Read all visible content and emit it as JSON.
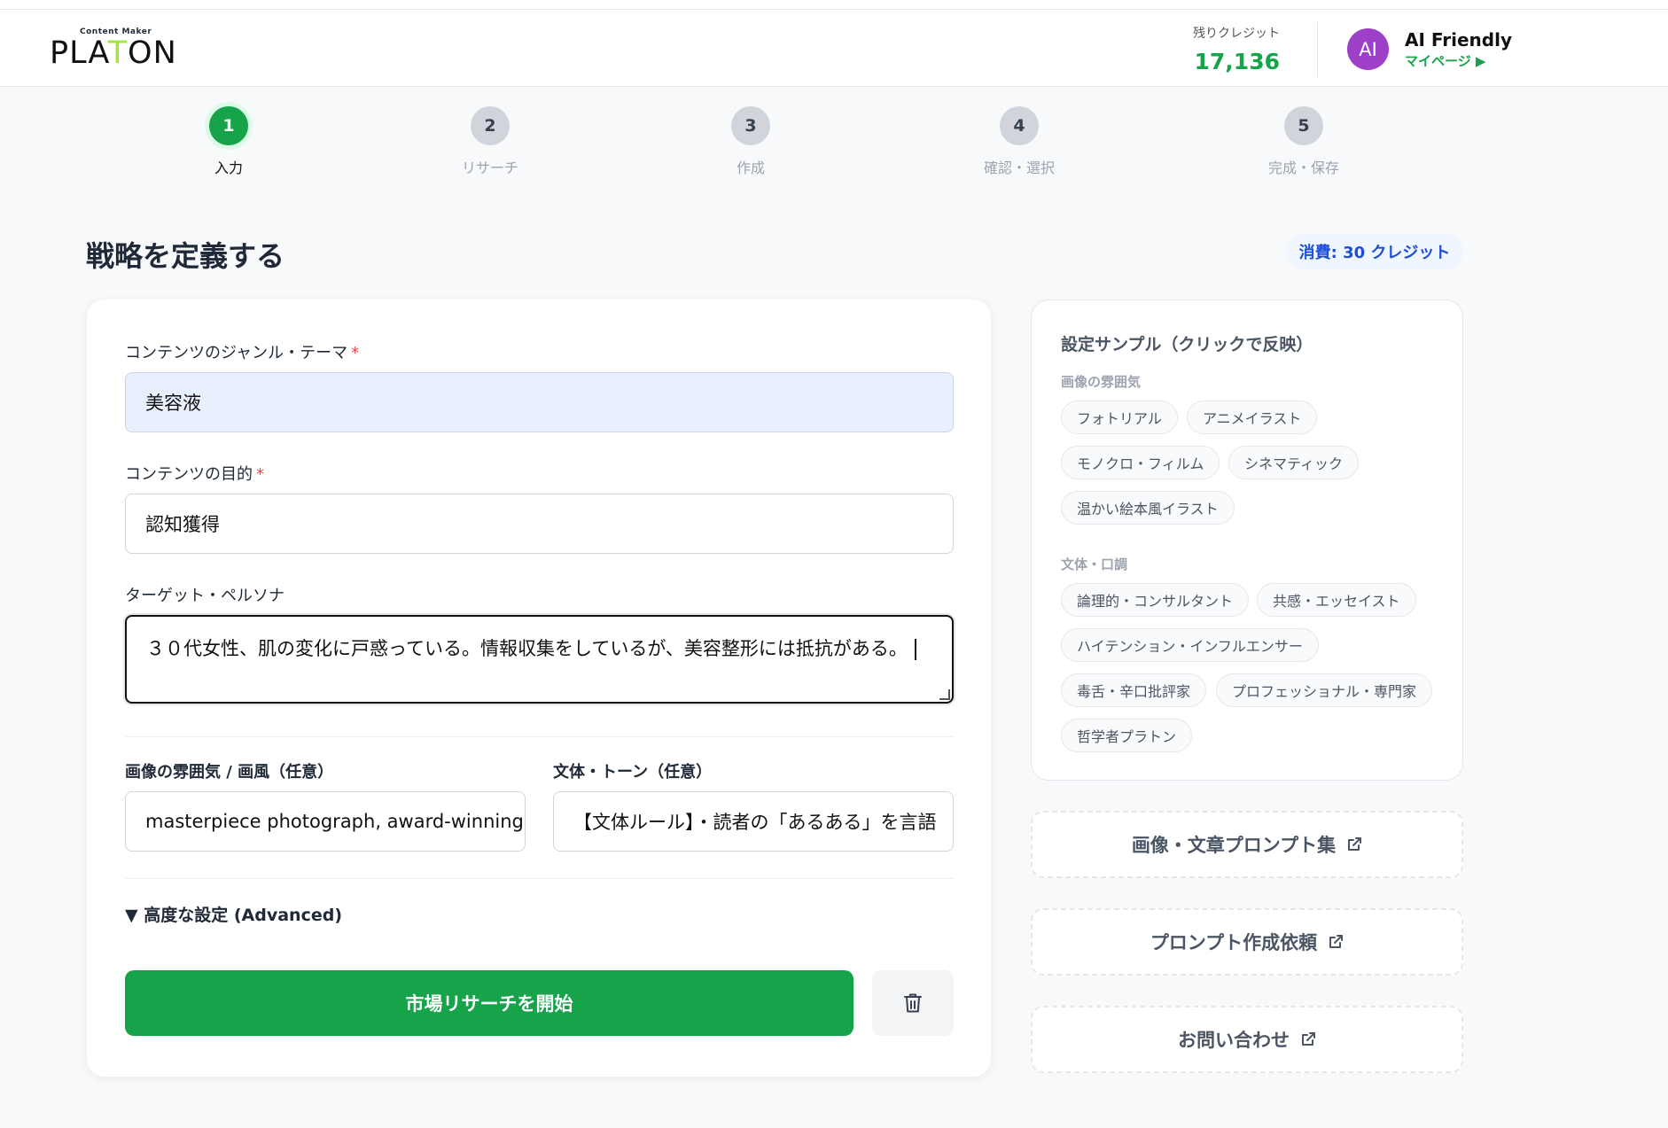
{
  "header": {
    "logo_sub": "Content Maker",
    "logo_main_pre": "PLA",
    "logo_main_t": "T",
    "logo_main_post": "ON",
    "credit_label": "残りクレジット",
    "credit_value": "17,136",
    "avatar_initials": "AI",
    "user_name": "AI Friendly",
    "mypage_link": "マイページ ▶"
  },
  "stepper": {
    "steps": [
      {
        "number": "1",
        "label": "入力"
      },
      {
        "number": "2",
        "label": "リサーチ"
      },
      {
        "number": "3",
        "label": "作成"
      },
      {
        "number": "4",
        "label": "確認・選択"
      },
      {
        "number": "5",
        "label": "完成・保存"
      }
    ],
    "active_step": 1
  },
  "main": {
    "title": "戦略を定義する",
    "cost_badge": "消費: 30 クレジット",
    "form": {
      "genre_label": "コンテンツのジャンル・テーマ",
      "genre_value": "美容液",
      "purpose_label": "コンテンツの目的",
      "purpose_value": "認知獲得",
      "persona_label": "ターゲット・ペルソナ",
      "persona_value": "３０代女性、肌の変化に戸惑っている。情報収集をしているが、美容整形には抵抗がある。",
      "image_style_label": "画像の雰囲気 / 画風（任意）",
      "image_style_value": "masterpiece photograph, award-winning",
      "tone_label": "文体・トーン（任意）",
      "tone_value": "【文体ルール】・読者の「あるある」を言語",
      "required_mark": "*",
      "advanced_label": "▼ 高度な設定 (Advanced)",
      "submit_label": "市場リサーチを開始"
    }
  },
  "samples": {
    "title": "設定サンプル（クリックで反映）",
    "image_mood_heading": "画像の雰囲気",
    "image_mood_chips": [
      "フォトリアル",
      "アニメイラスト",
      "モノクロ・フィルム",
      "シネマティック",
      "温かい絵本風イラスト"
    ],
    "tone_heading": "文体・口調",
    "tone_chips": [
      "論理的・コンサルタント",
      "共感・エッセイスト",
      "ハイテンション・インフルエンサー",
      "毒舌・辛口批評家",
      "プロフェッショナル・専門家",
      "哲学者プラトン"
    ]
  },
  "links": {
    "prompt_collection": "画像・文章プロンプト集",
    "prompt_request": "プロンプト作成依頼",
    "contact": "お問い合わせ"
  },
  "colors": {
    "accent": "#16a34a",
    "avatar": "#9d3fc9",
    "badge_text": "#1d4ed8",
    "required": "#ef4444"
  }
}
